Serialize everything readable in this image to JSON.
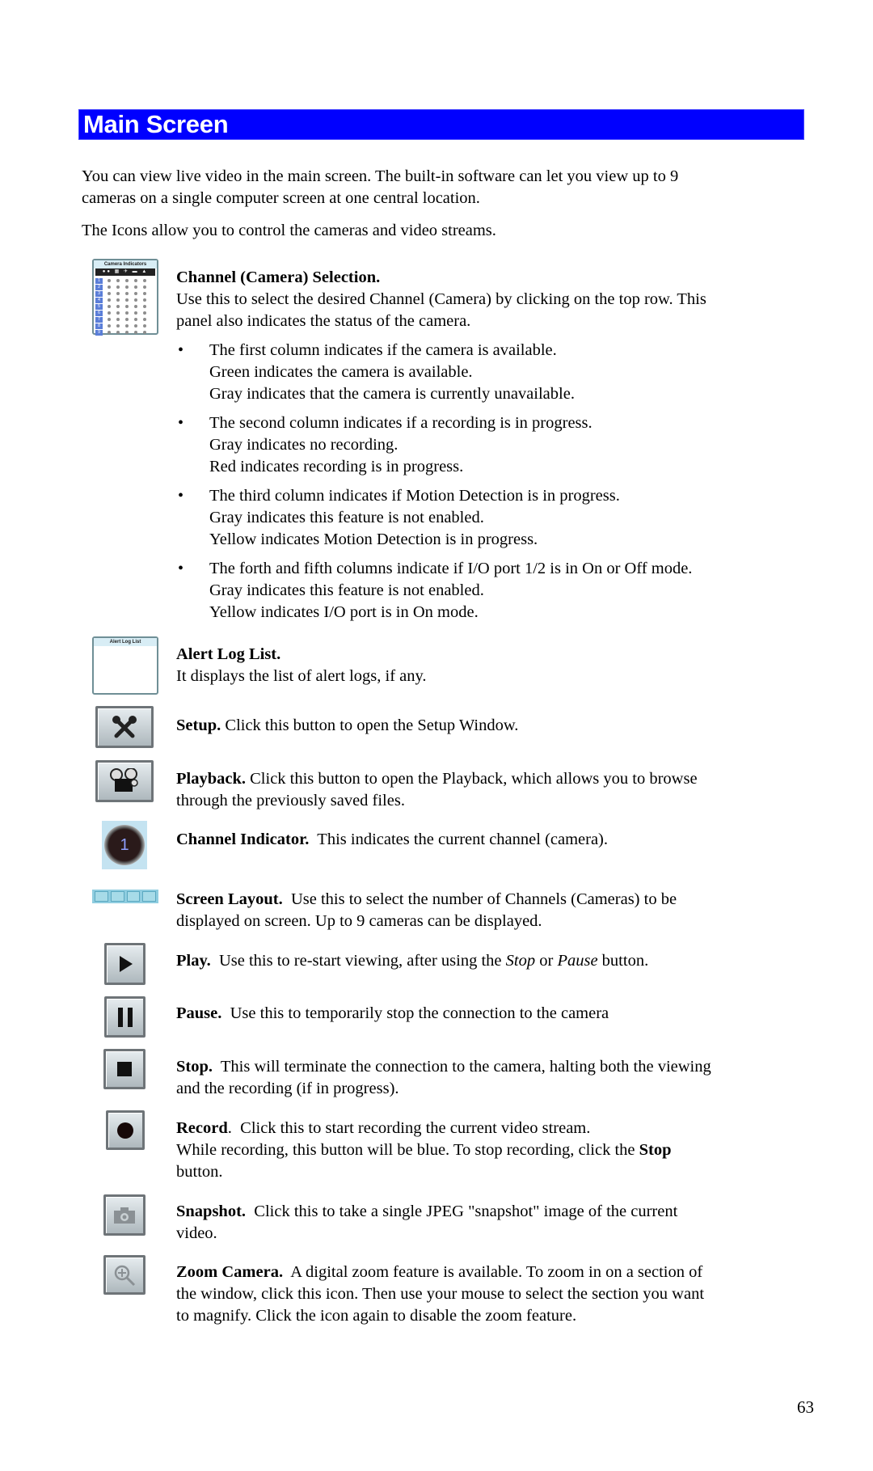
{
  "header": {
    "title": "Main Screen",
    "bar_color": "#0000ff"
  },
  "intro": {
    "line1": "You can view live video in the main screen. The built-in software can let you view up to 9",
    "line2": "cameras on a single computer screen at one central location.",
    "line3": "The Icons allow you to control the cameras and video streams."
  },
  "sections": {
    "channel_selection": {
      "icon": "camera-indicators-panel",
      "icon_title": "Camera Indicators",
      "channel_numbers": [
        "1",
        "2",
        "3",
        "4",
        "5",
        "6",
        "7",
        "8",
        "9"
      ],
      "title": "Channel (Camera) Selection.",
      "line1": "Use this to select the desired Channel (Camera) by clicking on the top row. This",
      "line2": "panel also indicates the status of the camera.",
      "bullets": [
        {
          "lines": [
            "The first column indicates if the camera is available.",
            "Green indicates the camera is available.",
            "Gray indicates that the camera is currently unavailable."
          ]
        },
        {
          "lines": [
            "The second column indicates if a recording is in progress.",
            "Gray indicates no recording.",
            "Red indicates recording is in progress."
          ]
        },
        {
          "lines": [
            "The third column indicates if Motion Detection is in progress.",
            "Gray indicates this feature is not enabled.",
            "Yellow indicates Motion Detection is in progress."
          ]
        },
        {
          "lines": [
            "The forth and fifth columns indicate if I/O port 1/2 is in On or Off mode.",
            "Gray indicates this feature is not enabled.",
            "Yellow indicates I/O port is in On mode."
          ]
        }
      ],
      "bullet_char": "•"
    },
    "alert_log": {
      "icon": "alert-log-list-panel",
      "icon_title": "Alert Log List",
      "title": "Alert Log List.",
      "line1": "It displays the list of alert logs, if any."
    },
    "setup": {
      "icon": "tools-icon",
      "title": "Setup.",
      "text": " Click this button to open the Setup Window."
    },
    "playback": {
      "icon": "film-reel-icon",
      "title": "Playback.",
      "text": " Click this button to open the Playback, which allows you to browse",
      "line2": "through the previously saved files."
    },
    "channel_indicator": {
      "icon": "channel-number-icon",
      "value": "1",
      "title": "Channel Indicator.",
      "text": "  This indicates the current channel (camera)."
    },
    "screen_layout": {
      "icon": "grid-layout-icon",
      "title": "Screen Layout.",
      "text": "  Use this to select the number of Channels (Cameras) to be",
      "line2": "displayed on screen. Up to 9 cameras can be displayed."
    },
    "play": {
      "icon": "play-icon",
      "title": "Play.",
      "text_a": "  Use this to re-start viewing, after using the ",
      "em1": "Stop",
      "text_b": " or ",
      "em2": "Pause",
      "text_c": " button."
    },
    "pause": {
      "icon": "pause-icon",
      "title": "Pause.",
      "text": "  Use this to temporarily stop the connection to the camera"
    },
    "stop": {
      "icon": "stop-icon",
      "title": "Stop.",
      "text": "  This will terminate the connection to the camera, halting both the viewing",
      "line2": "and the recording (if in progress)."
    },
    "record": {
      "icon": "record-icon",
      "title": "Record",
      "text": ".  Click this to start recording the current video stream.",
      "line2a": "While recording, this button will be blue. To stop recording, click the ",
      "line2b": "Stop",
      "line3": "button."
    },
    "snapshot": {
      "icon": "camera-icon",
      "title": "Snapshot.",
      "text": "  Click this to take a single JPEG \"snapshot\" image of the current",
      "line2": "video."
    },
    "zoom_camera": {
      "icon": "zoom-in-icon",
      "title": "Zoom Camera.",
      "text": "  A digital zoom feature is available. To zoom in on a section of",
      "line2": "the window, click this icon. Then use your mouse to select the section you want",
      "line3": "to magnify. Click the icon again to disable the zoom feature."
    }
  },
  "page_number": "63"
}
